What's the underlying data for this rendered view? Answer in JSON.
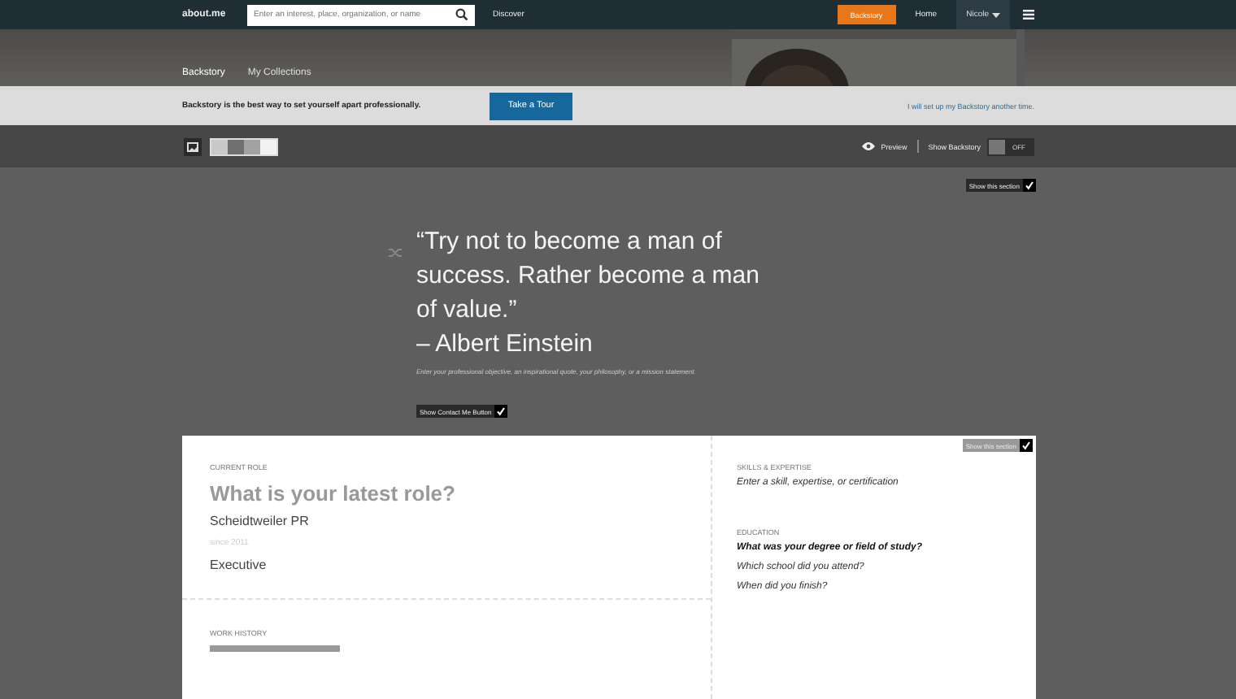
{
  "navbar": {
    "logo": "about.me",
    "search": {
      "placeholder": "Enter an interest, place, organization, or name"
    },
    "links": [
      "Discover"
    ],
    "backstory_button": "Backstory",
    "home": "Home",
    "user": "Nicole"
  },
  "hero": {
    "tabs": [
      {
        "label": "Backstory",
        "selected": true
      },
      {
        "label": "My Collections",
        "selected": false
      }
    ]
  },
  "banner": {
    "text": "Backstory is the best way to set yourself apart professionally.",
    "button": "Take a Tour",
    "link": "I will set up my Backstory another time."
  },
  "toolbar": {
    "swatches": [
      {
        "color": "#c8c8c8"
      },
      {
        "color": "#707070"
      },
      {
        "color": "#a2a2a2"
      },
      {
        "color": "#f2f2f2"
      }
    ],
    "preview": "Preview",
    "show_backstory": {
      "label": "Show Backstory",
      "on": false,
      "state_text": "OFF"
    }
  },
  "intro": {
    "show_section": {
      "label": "Show this section",
      "checked": true
    },
    "quote": "“Try not to become a man of success. Rather become a man of value.”",
    "author": "– Albert Einstein",
    "hint": "Enter your professional objective, an inspirational quote, your philosophy, or a mission statement.",
    "contact_button": {
      "label": "Show Contact Me Button",
      "checked": true
    }
  },
  "details": {
    "show_section": {
      "label": "Show this section",
      "checked": true
    },
    "current_role": {
      "heading": "CURRENT ROLE",
      "title": "What is your latest role?",
      "company": "Scheidtweiler PR",
      "since": "since 2011",
      "position": "Executive"
    },
    "work_history": {
      "heading": "WORK HISTORY"
    },
    "skills": {
      "heading": "SKILLS & EXPERTISE",
      "placeholder": "Enter a skill, expertise, or certification"
    },
    "education": {
      "heading": "EDUCATION",
      "items": [
        {
          "text": "What was your degree or field of study?",
          "emphasis": true
        },
        {
          "text": "Which school did you attend?",
          "emphasis": false
        },
        {
          "text": "When did you finish?",
          "emphasis": false
        }
      ]
    }
  }
}
